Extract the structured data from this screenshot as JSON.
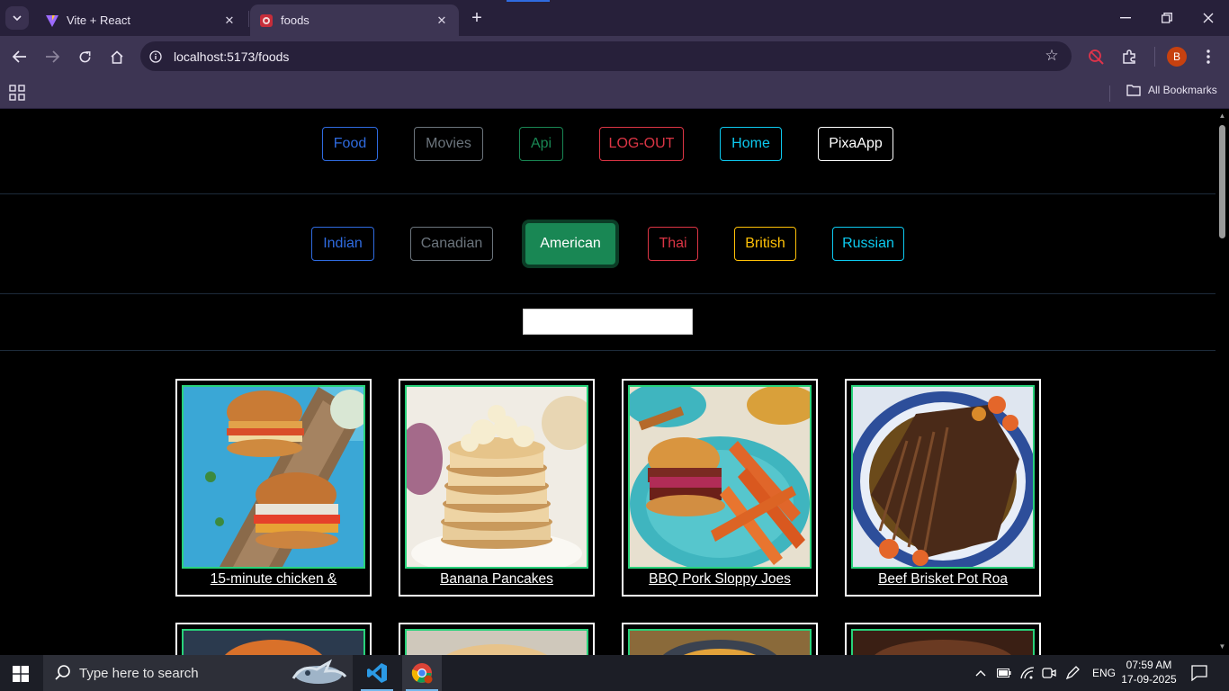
{
  "browser": {
    "tabs": [
      {
        "title": "Vite + React",
        "active": false
      },
      {
        "title": "foods",
        "active": true
      }
    ],
    "url": "localhost:5173/foods",
    "bookmarks_label": "All Bookmarks",
    "profile_initial": "B"
  },
  "nav": {
    "buttons": [
      {
        "label": "Food",
        "color": "#2f6be0"
      },
      {
        "label": "Movies",
        "color": "#6c757d"
      },
      {
        "label": "Api",
        "color": "#198754"
      },
      {
        "label": "LOG-OUT",
        "color": "#dc3545"
      },
      {
        "label": "Home",
        "color": "#0dcaf0"
      },
      {
        "label": "PixaApp",
        "color": "#ffffff"
      }
    ]
  },
  "areas": {
    "buttons": [
      {
        "label": "Indian",
        "color": "#2f6be0",
        "active": false
      },
      {
        "label": "Canadian",
        "color": "#6c757d",
        "active": false
      },
      {
        "label": "American",
        "color": "#198754",
        "active": true
      },
      {
        "label": "Thai",
        "color": "#dc3545",
        "active": false
      },
      {
        "label": "British",
        "color": "#ffc107",
        "active": false
      },
      {
        "label": "Russian",
        "color": "#0dcaf0",
        "active": false
      }
    ]
  },
  "search": {
    "value": "",
    "placeholder": ""
  },
  "meals": [
    {
      "name": "15-minute chicken &"
    },
    {
      "name": "Banana Pancakes"
    },
    {
      "name": "BBQ Pork Sloppy Joes"
    },
    {
      "name": "Beef Brisket Pot Roa"
    },
    {
      "name": ""
    },
    {
      "name": ""
    },
    {
      "name": ""
    },
    {
      "name": ""
    }
  ],
  "taskbar": {
    "search_placeholder": "Type here to search",
    "language": "ENG",
    "time": "07:59 AM",
    "date": "17-09-2025"
  }
}
